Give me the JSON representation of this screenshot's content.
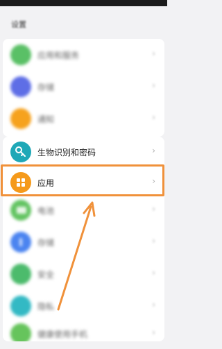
{
  "header": {
    "title": "设置"
  },
  "rows_top": [
    {
      "label": "应用和服务",
      "color": "#5ac066"
    },
    {
      "label": "存储",
      "color": "#5e6ee6"
    },
    {
      "label": "通知",
      "color": "#f6a21e"
    }
  ],
  "biometrics": {
    "label": "生物识别和密码",
    "color": "#1fa8b7"
  },
  "apps": {
    "label": "应用",
    "color": "#f59a1b"
  },
  "rows_bottom": [
    {
      "label": "电池",
      "color": "#63c462"
    },
    {
      "label": "存储",
      "color": "#4b84f0"
    },
    {
      "label": "安全",
      "color": "#4cbb6c"
    },
    {
      "label": "隐私",
      "color": "#33b9c4"
    },
    {
      "label": "健康使用手机",
      "color": "#66c45c"
    }
  ],
  "chevron": "›",
  "accent": "#f0913a"
}
